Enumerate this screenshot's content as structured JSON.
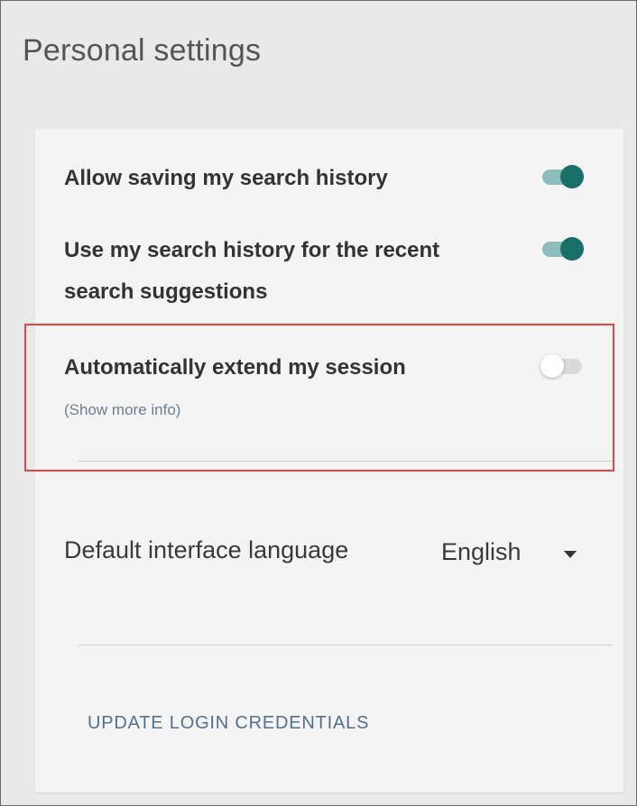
{
  "page": {
    "title": "Personal settings"
  },
  "settings": {
    "save_history": {
      "label": "Allow saving my search history",
      "enabled": true
    },
    "use_history": {
      "label": "Use my search history for the recent search suggestions",
      "line1": "Use my search history for the recent",
      "line2": "search suggestions",
      "enabled": true
    },
    "extend_session": {
      "label": "Automatically extend my session",
      "enabled": false,
      "more_info": "(Show more info)"
    }
  },
  "language": {
    "label": "Default interface language",
    "value": "English"
  },
  "credentials": {
    "link_label": "UPDATE LOGIN CREDENTIALS"
  },
  "colors": {
    "toggle_on_knob": "#1a6f6a",
    "toggle_on_track": "#8fbdb9",
    "toggle_off_track": "#dadada",
    "highlight": "#e84545",
    "link": "#55708a"
  }
}
